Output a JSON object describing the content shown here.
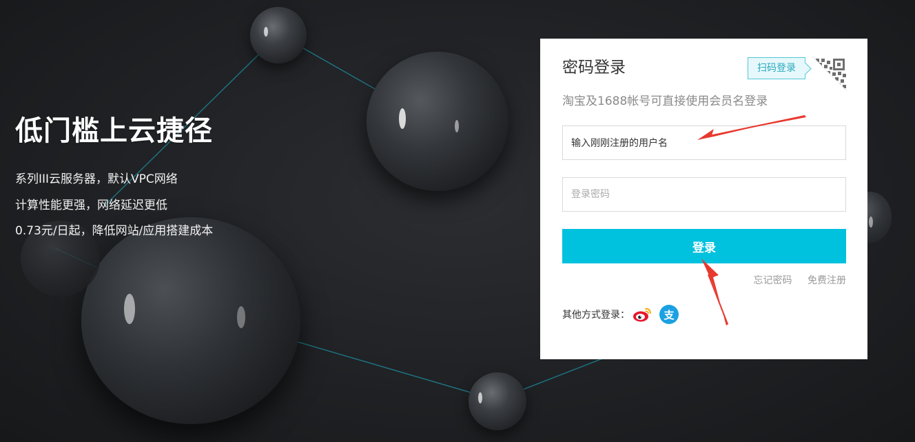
{
  "hero": {
    "title": "低门槛上云捷径",
    "lines": [
      "系列III云服务器，默认VPC网络",
      "计算性能更强，网络延迟更低",
      "0.73元/日起，降低网站/应用搭建成本"
    ]
  },
  "login": {
    "title": "密码登录",
    "qr_tip": "扫码登录",
    "subtitle": "淘宝及1688帐号可直接使用会员名登录",
    "username": {
      "value": "输入刚刚注册的用户名",
      "placeholder": ""
    },
    "password": {
      "value": "",
      "placeholder": "登录密码"
    },
    "submit_label": "登录",
    "forgot_password": "忘记密码",
    "free_register": "免费注册",
    "other_methods_label": "其他方式登录：",
    "social": [
      "weibo-icon",
      "alipay-icon"
    ],
    "alipay_glyph": "支"
  },
  "colors": {
    "accent": "#00c1de",
    "qr_tip_border": "#53c7d8",
    "annotation": "#e8392f",
    "background": "#1f2124"
  }
}
